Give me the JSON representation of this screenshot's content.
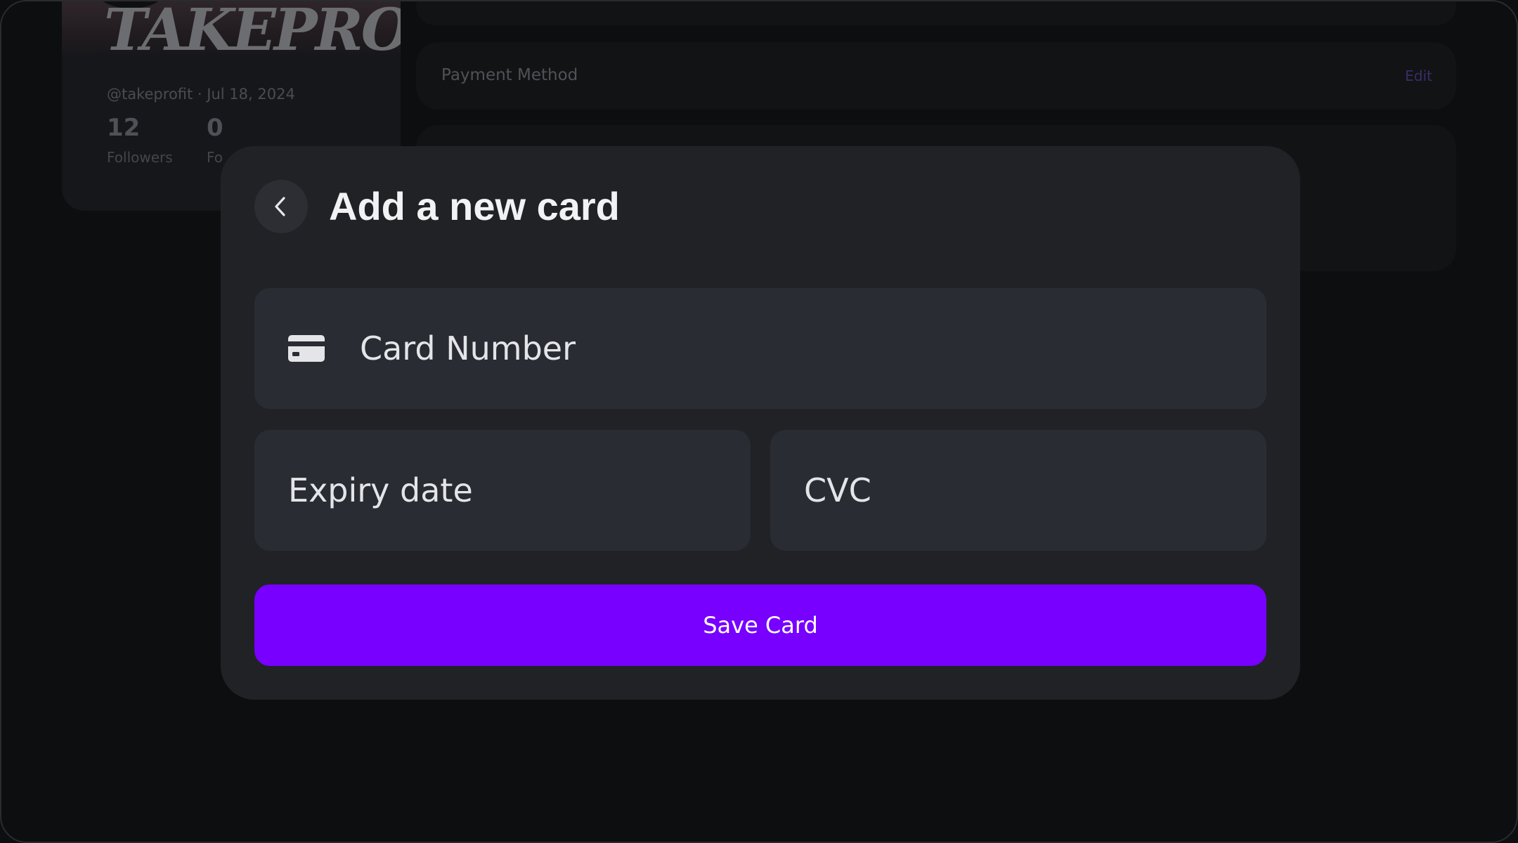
{
  "background": {
    "profile": {
      "logo_text": "TAKEPROFIT",
      "handle_line": "@takeprofit · Jul 18, 2024",
      "stats": [
        {
          "value": "12",
          "label": "Followers"
        },
        {
          "value": "0",
          "label": "Fo"
        }
      ]
    },
    "payment": {
      "label": "Payment Method",
      "edit_label": "Edit"
    }
  },
  "modal": {
    "title": "Add a new card",
    "back_icon": "chevron-left-icon",
    "card_number": {
      "placeholder": "Card Number",
      "value": "",
      "icon": "credit-card-icon"
    },
    "expiry": {
      "placeholder": "Expiry date",
      "value": ""
    },
    "cvc": {
      "placeholder": "CVC",
      "value": ""
    },
    "save_label": "Save Card"
  },
  "colors": {
    "accent": "#7700ff",
    "modal_bg": "#202226",
    "field_bg": "#2a2c33",
    "page_bg": "#0d0e10"
  }
}
